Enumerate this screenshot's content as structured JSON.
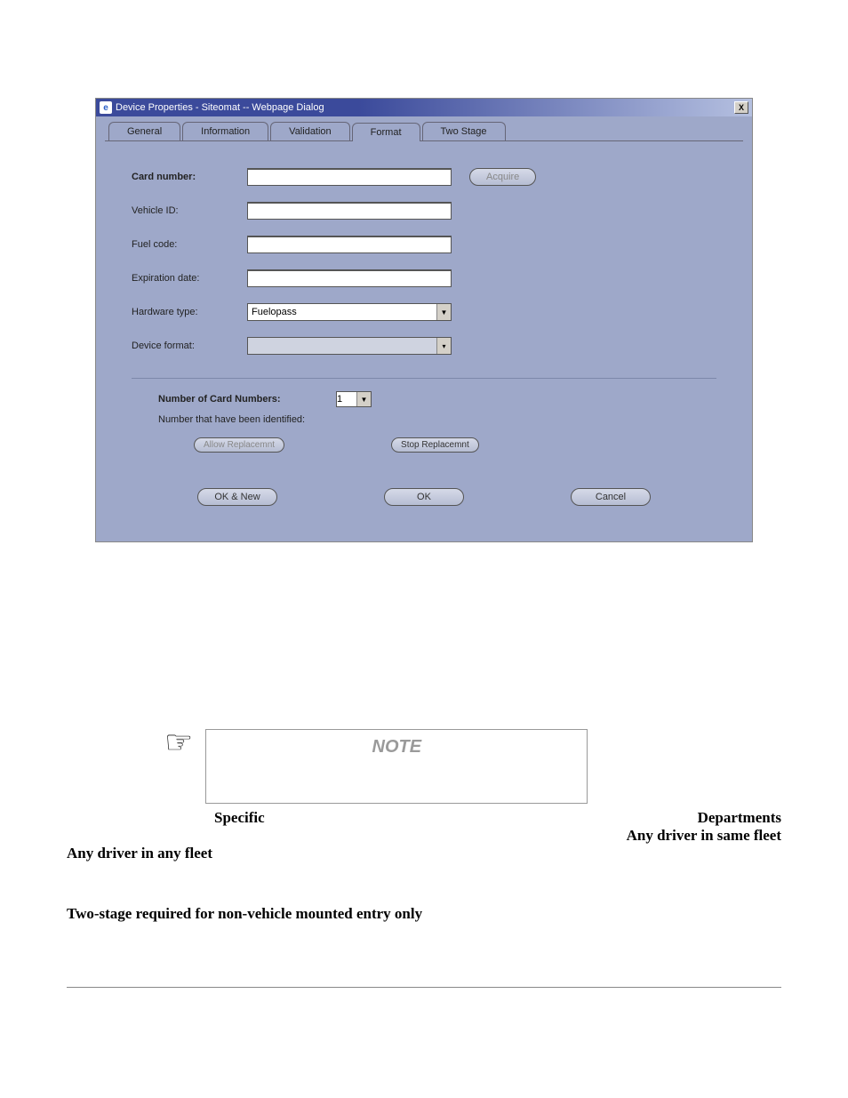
{
  "dialog": {
    "title": "Device Properties - Siteomat -- Webpage Dialog",
    "close_glyph": "X",
    "ie_glyph": "e",
    "tabs": [
      "General",
      "Information",
      "Validation",
      "Format",
      "Two Stage"
    ],
    "fields": {
      "card_number_label": "Card number:",
      "vehicle_id_label": "Vehicle ID:",
      "fuel_code_label": "Fuel code:",
      "expiration_date_label": "Expiration date:",
      "hardware_type_label": "Hardware type:",
      "device_format_label": "Device format:",
      "card_number": "",
      "vehicle_id": "",
      "fuel_code": "",
      "expiration_date": "",
      "hardware_type": "Fuelopass",
      "device_format": ""
    },
    "acquire_label": "Acquire",
    "group2": {
      "num_card_numbers_label": "Number of Card Numbers:",
      "num_card_numbers": "1",
      "identified_label": "Number that have been identified:",
      "allow_replacement_label": "Allow Replacemnt",
      "stop_replacement_label": "Stop Replacemnt"
    },
    "buttons": {
      "ok_new": "OK & New",
      "ok": "OK",
      "cancel": "Cancel"
    }
  },
  "note": {
    "title": "NOTE",
    "specific": "Specific",
    "departments": "Departments",
    "any_same_fleet": "Any driver in same fleet",
    "any_any_fleet": "Any driver in any fleet",
    "subhead": "Two-stage required for non-vehicle mounted entry only"
  }
}
